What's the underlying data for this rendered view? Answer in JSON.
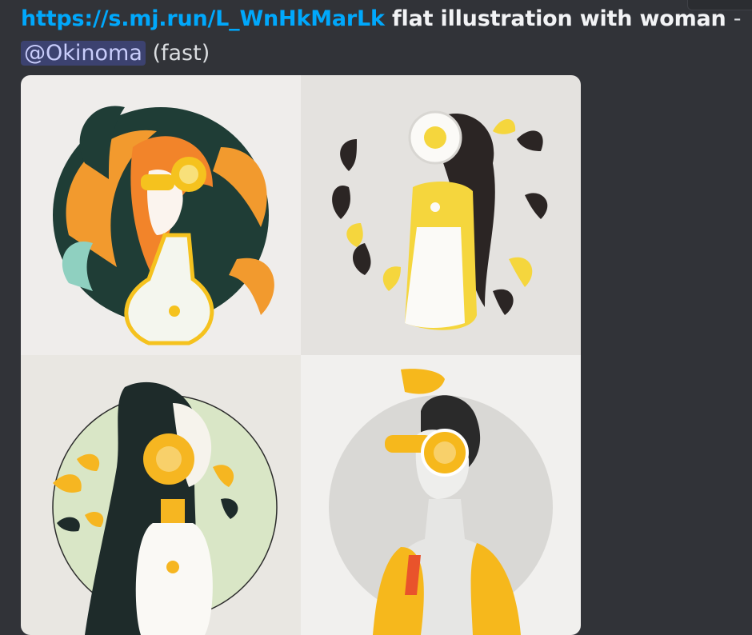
{
  "message": {
    "link": "https://s.mj.run/L_WnHkMarLk",
    "prompt": "flat illustration with woman",
    "separator": "-",
    "mention": "@Okinoma",
    "mode": "(fast)"
  },
  "images": [
    {
      "position": "top-left",
      "background": "#efedeb",
      "accent": "#f29a2e"
    },
    {
      "position": "top-right",
      "background": "#e4e2df",
      "accent": "#f5d63d"
    },
    {
      "position": "bottom-left",
      "background": "#e9e7e2",
      "accent": "#f6b621"
    },
    {
      "position": "bottom-right",
      "background": "#f1f0ee",
      "accent": "#f6b81c"
    }
  ],
  "colors": {
    "background": "#313338",
    "link": "#00a8fc",
    "mention_bg": "#3c4270",
    "mention_text": "#c9cdfb"
  }
}
